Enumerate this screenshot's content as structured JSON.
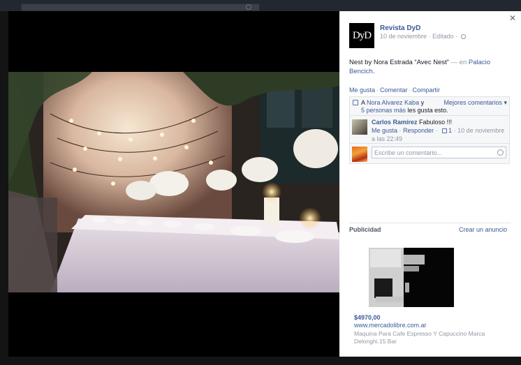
{
  "post": {
    "page_name": "Revista DyD",
    "logo_text": "DyD",
    "date": "10 de noviembre",
    "edited": "Editado",
    "text": "Nest by Nora Estrada “Avec Nest”",
    "location_prefix": "— en",
    "location": "Palacio Bencich",
    "period": "."
  },
  "actions": {
    "like": "Me gusta",
    "comment": "Comentar",
    "share": "Compartir"
  },
  "likes": {
    "prefix": "A",
    "person": "Nora Alvarez Kaba",
    "conj": "y",
    "others": "5 personas más",
    "suffix": "les gusta esto.",
    "sort_label": "Mejores comentarios"
  },
  "comment": {
    "author": "Carlos Ramírez",
    "text": "Fabuloso !!!",
    "like": "Me gusta",
    "reply": "Responder",
    "like_count": "1",
    "time": "10 de noviembre a las 22:49"
  },
  "reply_box": {
    "placeholder": "Escribe un comentario..."
  },
  "ads": {
    "title": "Publicidad",
    "create": "Crear un anuncio",
    "price": "$4970,00",
    "url": "www.mercadolibre.com.ar",
    "description": "Maquina Para Cafe Espresso Y Capuccino Marca Delonghi.15 Bar"
  },
  "colors": {
    "link": "#3b5998",
    "muted": "#9197a3",
    "panel_bg": "#ffffff",
    "ufi_bg": "#f6f7f8"
  },
  "icons": [
    "close-icon",
    "globe-icon",
    "thumbs-up-icon",
    "chevron-down-icon",
    "smiley-icon"
  ]
}
